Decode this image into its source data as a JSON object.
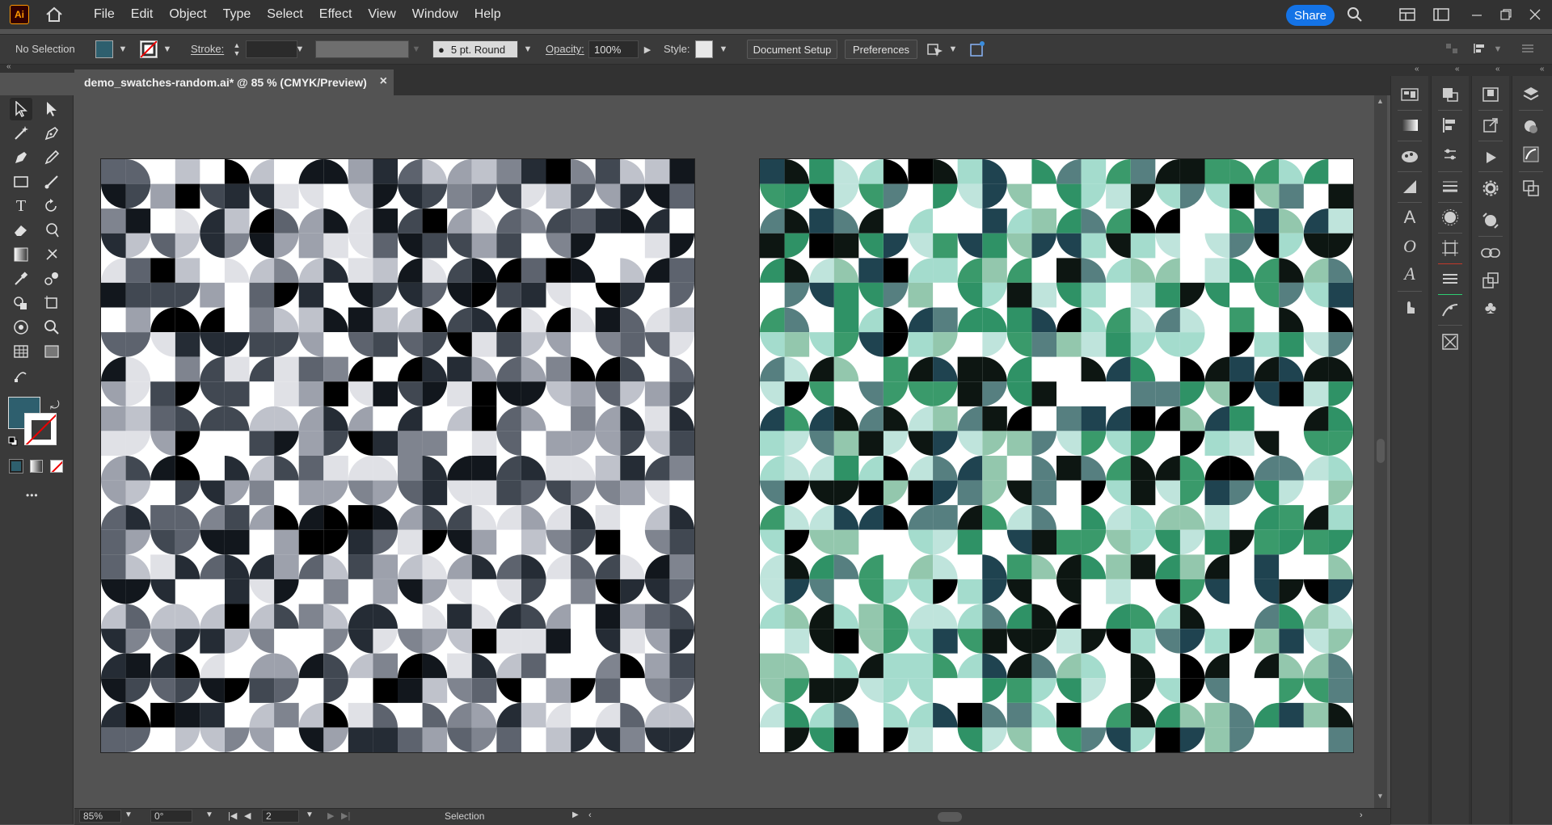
{
  "app": {
    "logo": "Ai"
  },
  "menu": [
    "File",
    "Edit",
    "Object",
    "Type",
    "Select",
    "Effect",
    "View",
    "Window",
    "Help"
  ],
  "share_label": "Share",
  "control_bar": {
    "selection_label": "No Selection",
    "stroke_label": "Stroke:",
    "brush_label": "5 pt. Round",
    "opacity_label": "Opacity:",
    "opacity_value": "100%",
    "style_label": "Style:",
    "document_setup": "Document Setup",
    "preferences": "Preferences"
  },
  "document_tab": {
    "title": "demo_swatches-random.ai* @ 85 % (CMYK/Preview)",
    "close": "×"
  },
  "fill_color": "#2e5f6e",
  "artboards": [
    {
      "palette": [
        "#ffffff",
        "#e0e1e6",
        "#bfc2cb",
        "#9da1ac",
        "#7f848f",
        "#5d636e",
        "#414852",
        "#252c35",
        "#12171d",
        "#000000"
      ]
    },
    {
      "palette": [
        "#ffffff",
        "#bfe4dc",
        "#a4dccd",
        "#93c7ad",
        "#3a9a6b",
        "#2f9266",
        "#567f80",
        "#1f4350",
        "#0d1612",
        "#000000"
      ]
    }
  ],
  "status": {
    "zoom": "85%",
    "rotation": "0°",
    "artboard_number": "2",
    "tool": "Selection"
  },
  "more_tools": "•••"
}
